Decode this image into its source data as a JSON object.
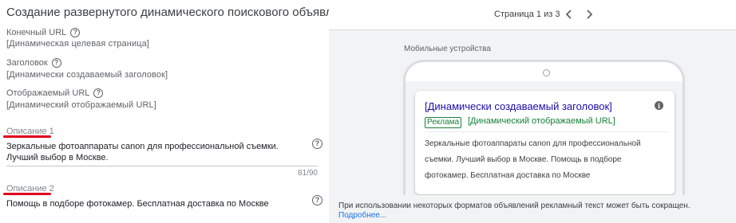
{
  "form": {
    "title": "Создание развернутого динамического поискового объявления",
    "final_url": {
      "label": "Конечный URL",
      "value": "[Динамическая целевая страница]"
    },
    "headline": {
      "label": "Заголовок",
      "value": "[Динамически создаваемый заголовок]"
    },
    "display_url": {
      "label": "Отображаемый URL",
      "value": "[Динамический отображаемый URL]"
    },
    "description1": {
      "label": "Описание 1",
      "value": "Зеркальные фотоаппараты canon для профессиональной съемки. Лучший выбор в Москве.",
      "counter": "81/90"
    },
    "description2": {
      "label": "Описание 2",
      "value": "Помощь в подборе фотокамер. Бесплатная доставка по Москве"
    },
    "help_glyph": "?"
  },
  "preview": {
    "pager_text": "Страница 1 из 3",
    "device_caption": "Мобильные устройства",
    "ad": {
      "headline": "[Динамически создаваемый заголовок]",
      "badge": "Реклама",
      "display_url": "[Динамический отображаемый URL]",
      "description": "Зеркальные фотоаппараты canon для профессиональной съемки. Лучший выбор в Москве. Помощь в подборе фотокамер. Бесплатная доставка по Москве",
      "info_glyph": "i"
    },
    "note": "При использовании некоторых форматов объявлений рекламный текст может быть сокращен.",
    "note_link": "Подробнее..."
  },
  "colors": {
    "link_blue": "#1a0dab",
    "url_green": "#188038",
    "annotation_red": "#e0001b",
    "panel_gray": "#f1f3f4"
  },
  "icons": [
    "help-icon",
    "chevron-left-icon",
    "chevron-right-icon",
    "info-icon",
    "camera-icon"
  ]
}
